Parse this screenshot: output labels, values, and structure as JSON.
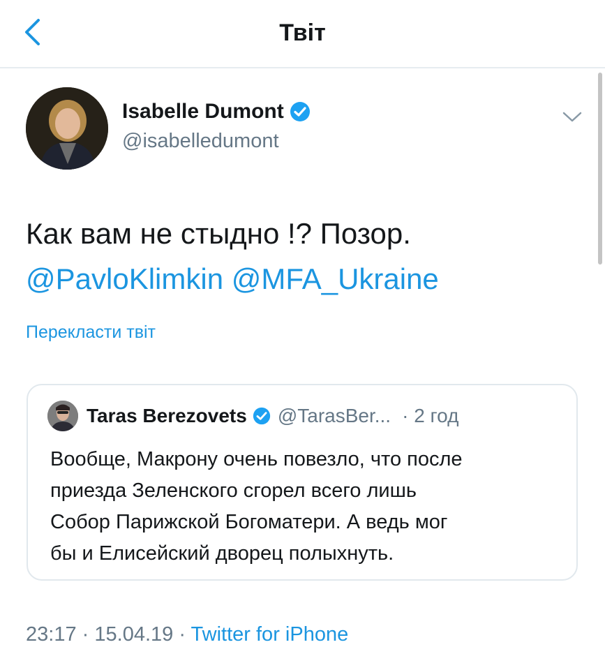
{
  "header": {
    "title": "Твіт",
    "back_icon": "chevron-left-icon"
  },
  "colors": {
    "accent": "#1b95e0",
    "text_primary": "#14171a",
    "text_secondary": "#657786",
    "border": "#e1e8ed",
    "verified": "#1da1f2"
  },
  "tweet": {
    "author": {
      "name": "Isabelle Dumont",
      "handle": "@isabelledumont",
      "verified": true
    },
    "text": "Как вам не стыдно !?  Позор.",
    "mentions": [
      "@PavloKlimkin",
      "@MFA_Ukraine"
    ],
    "translate_label": "Перекласти твіт",
    "time": "23:17",
    "date": "15.04.19",
    "source": "Twitter for iPhone",
    "separator": "·"
  },
  "quoted_tweet": {
    "author": {
      "name": "Taras Berezovets",
      "handle": "@TarasBer...",
      "verified": true
    },
    "time": "· 2 год",
    "lines": [
      "Вообще, Макрону очень повезло, что после",
      "приезда Зеленского сгорел всего лишь",
      "Собор Парижской Богоматери. А ведь мог",
      "бы и Елисейский дворец полыхнуть."
    ]
  }
}
